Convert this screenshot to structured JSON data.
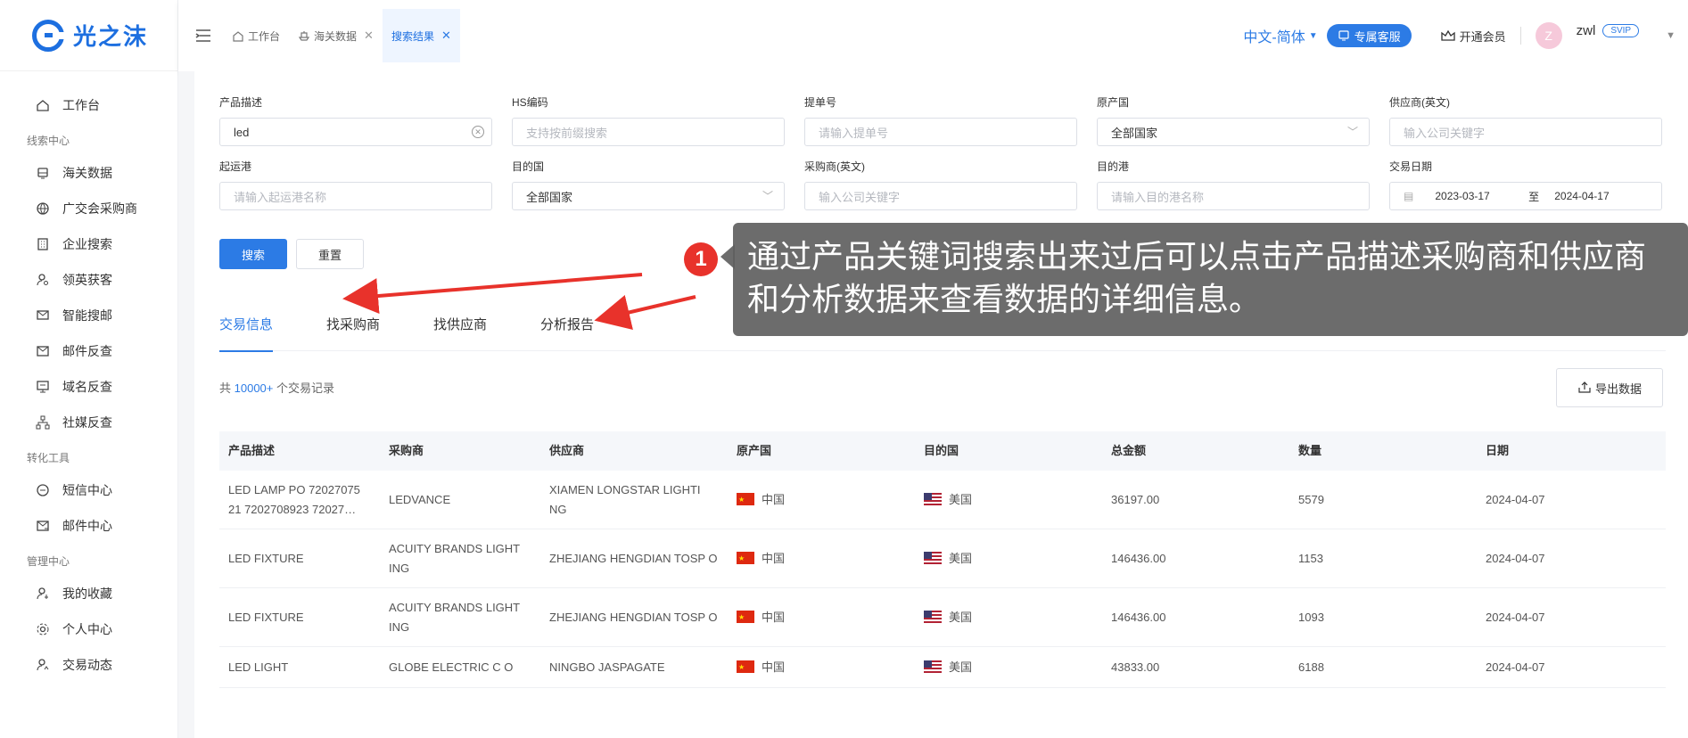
{
  "brand": {
    "name": "光之沫",
    "color": "#1d6fe0"
  },
  "sidebar": {
    "items": [
      {
        "label": "工作台",
        "icon": "home-icon"
      },
      {
        "group": "线索中心"
      },
      {
        "label": "海关数据",
        "icon": "ship-icon"
      },
      {
        "label": "广交会采购商",
        "icon": "globe-icon"
      },
      {
        "label": "企业搜索",
        "icon": "building-icon"
      },
      {
        "label": "领英获客",
        "icon": "user-search-icon"
      },
      {
        "label": "智能搜邮",
        "icon": "mail-search-icon"
      },
      {
        "label": "邮件反查",
        "icon": "mail-icon"
      },
      {
        "label": "域名反查",
        "icon": "monitor-icon"
      },
      {
        "label": "社媒反查",
        "icon": "network-icon"
      },
      {
        "group": "转化工具"
      },
      {
        "label": "短信中心",
        "icon": "chat-icon"
      },
      {
        "label": "邮件中心",
        "icon": "send-mail-icon"
      },
      {
        "group": "管理中心"
      },
      {
        "label": "我的收藏",
        "icon": "user-star-icon"
      },
      {
        "label": "个人中心",
        "icon": "gear-icon"
      },
      {
        "label": "交易动态",
        "icon": "user-activity-icon"
      }
    ]
  },
  "header": {
    "tabs": [
      {
        "label": "工作台",
        "closable": false
      },
      {
        "label": "海关数据",
        "closable": true
      },
      {
        "label": "搜索结果",
        "closable": true,
        "active": true
      }
    ],
    "language": "中文-简体",
    "service": "专属客服",
    "vip": "开通会员",
    "avatar_letter": "Z",
    "username": "zwl",
    "badge": "SVIP"
  },
  "filters": {
    "product_desc": {
      "label": "产品描述",
      "value": "led"
    },
    "hs_code": {
      "label": "HS编码",
      "placeholder": "支持按前缀搜索"
    },
    "bill_no": {
      "label": "提单号",
      "placeholder": "请输入提单号"
    },
    "origin_country": {
      "label": "原产国",
      "value": "全部国家"
    },
    "supplier": {
      "label": "供应商(英文)",
      "placeholder": "输入公司关键字"
    },
    "port_from": {
      "label": "起运港",
      "placeholder": "请输入起运港名称"
    },
    "dest_country": {
      "label": "目的国",
      "value": "全部国家"
    },
    "buyer": {
      "label": "采购商(英文)",
      "placeholder": "输入公司关键字"
    },
    "port_to": {
      "label": "目的港",
      "placeholder": "请输入目的港名称"
    },
    "date": {
      "label": "交易日期",
      "start": "2023-03-17",
      "sep": "至",
      "end": "2024-04-17"
    },
    "search_btn": "搜索",
    "reset_btn": "重置"
  },
  "result_tabs": [
    "交易信息",
    "找采购商",
    "找供应商",
    "分析报告"
  ],
  "records": {
    "prefix": "共",
    "count": "10000+",
    "suffix": "个交易记录",
    "export": "导出数据"
  },
  "table": {
    "headers": [
      "产品描述",
      "采购商",
      "供应商",
      "原产国",
      "目的国",
      "总金额",
      "数量",
      "日期"
    ],
    "rows": [
      {
        "desc": "LED LAMP PO 72027075 21 7202708923 72027…",
        "buyer": "LEDVANCE",
        "supplier": "XIAMEN LONGSTAR LIGHTI NG",
        "origin": "中国",
        "dest": "美国",
        "amount": "36197.00",
        "qty": "5579",
        "date": "2024-04-07"
      },
      {
        "desc": "LED FIXTURE",
        "buyer": "ACUITY BRANDS LIGHT ING",
        "supplier": "ZHEJIANG HENGDIAN TOSP O",
        "origin": "中国",
        "dest": "美国",
        "amount": "146436.00",
        "qty": "1153",
        "date": "2024-04-07"
      },
      {
        "desc": "LED FIXTURE",
        "buyer": "ACUITY BRANDS LIGHT ING",
        "supplier": "ZHEJIANG HENGDIAN TOSP O",
        "origin": "中国",
        "dest": "美国",
        "amount": "146436.00",
        "qty": "1093",
        "date": "2024-04-07"
      },
      {
        "desc": "LED LIGHT",
        "buyer": "GLOBE ELECTRIC C O",
        "supplier": "NINGBO JASPAGATE",
        "origin": "中国",
        "dest": "美国",
        "amount": "43833.00",
        "qty": "6188",
        "date": "2024-04-07"
      }
    ]
  },
  "annotation": {
    "number": "1",
    "text": "通过产品关键词搜索出来过后可以点击产品描述采购商和供应商和分析数据来查看数据的详细信息。"
  }
}
